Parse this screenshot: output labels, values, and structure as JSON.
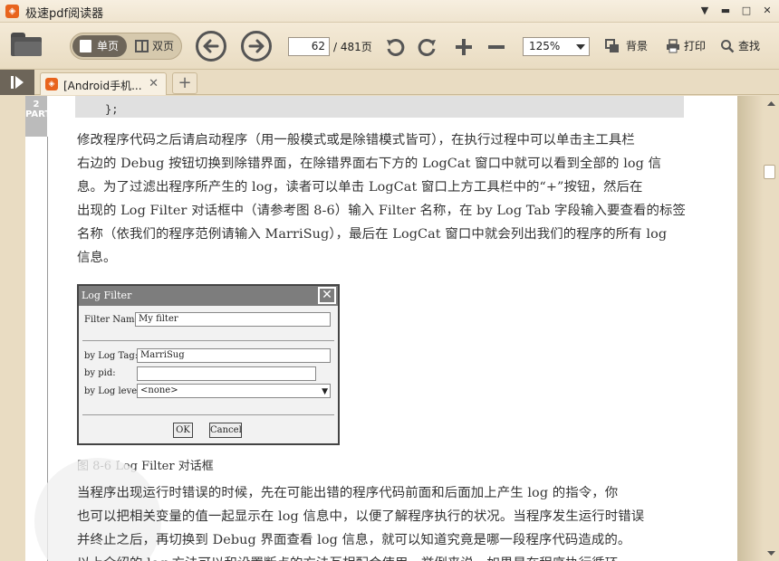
{
  "window": {
    "title": "极速pdf阅读器",
    "logo": "pdf-logo"
  },
  "toolbar": {
    "single_label": "单页",
    "double_label": "双页",
    "page_current": "62",
    "page_total": "/ 481页",
    "zoom_value": "125%",
    "background_label": "背景",
    "print_label": "打印",
    "search_label": "查找"
  },
  "tabs": [
    {
      "label": "[Android手机..."
    }
  ],
  "document": {
    "part_tab": "2 PART",
    "code_line": "};",
    "paragraph1": [
      "修改程序代码之后请启动程序（用一般模式或是除错模式皆可），在执行过程中可以单击主工具栏",
      "右边的 Debug 按钮切换到除错界面，在除错界面右下方的 LogCat 窗口中就可以看到全部的 log 信",
      "息。为了过滤出程序所产生的 log，读者可以单击 LogCat 窗口上方工具栏中的“+”按钮，然后在",
      "出现的 Log Filter 对话框中（请参考图 8-6）输入 Filter 名称，在 by Log Tab 字段输入要查看的标签",
      "名称（依我们的程序范例请输入 MarriSug），最后在 LogCat 窗口中就会列出我们的程序的所有 log",
      "信息。"
    ],
    "figure": {
      "title": "Log Filter",
      "filter_name_label": "Filter Name:",
      "filter_name_value": "My filter",
      "log_tag_label": "by Log Tag:",
      "log_tag_value": "MarriSug",
      "pid_label": "by pid:",
      "pid_value": "",
      "log_level_label": "by Log level:",
      "log_level_value": "<none>",
      "ok_label": "OK",
      "cancel_label": "Cancel"
    },
    "caption": "图 8-6    Log Filter 对话框",
    "paragraph2": [
      "    当程序出现运行时错误的时候，先在可能出错的程序代码前面和后面加上产生 log 的指令，你",
      "也可以把相关变量的值一起显示在 log 信息中，以便了解程序执行的状况。当程序发生运行时错误",
      "并终止之后，再切换到 Debug 界面查看 log 信息，就可以知道究竟是哪一段程序代码造成的。",
      "    以上介绍的 log 方法可以和设置断点的方法互相配合使用，举例来说，如果是在程序执行循环"
    ]
  },
  "colors": {
    "accent": "#e8641d",
    "chrome": "#e9dcc2",
    "toggle_active": "#6d6559"
  }
}
